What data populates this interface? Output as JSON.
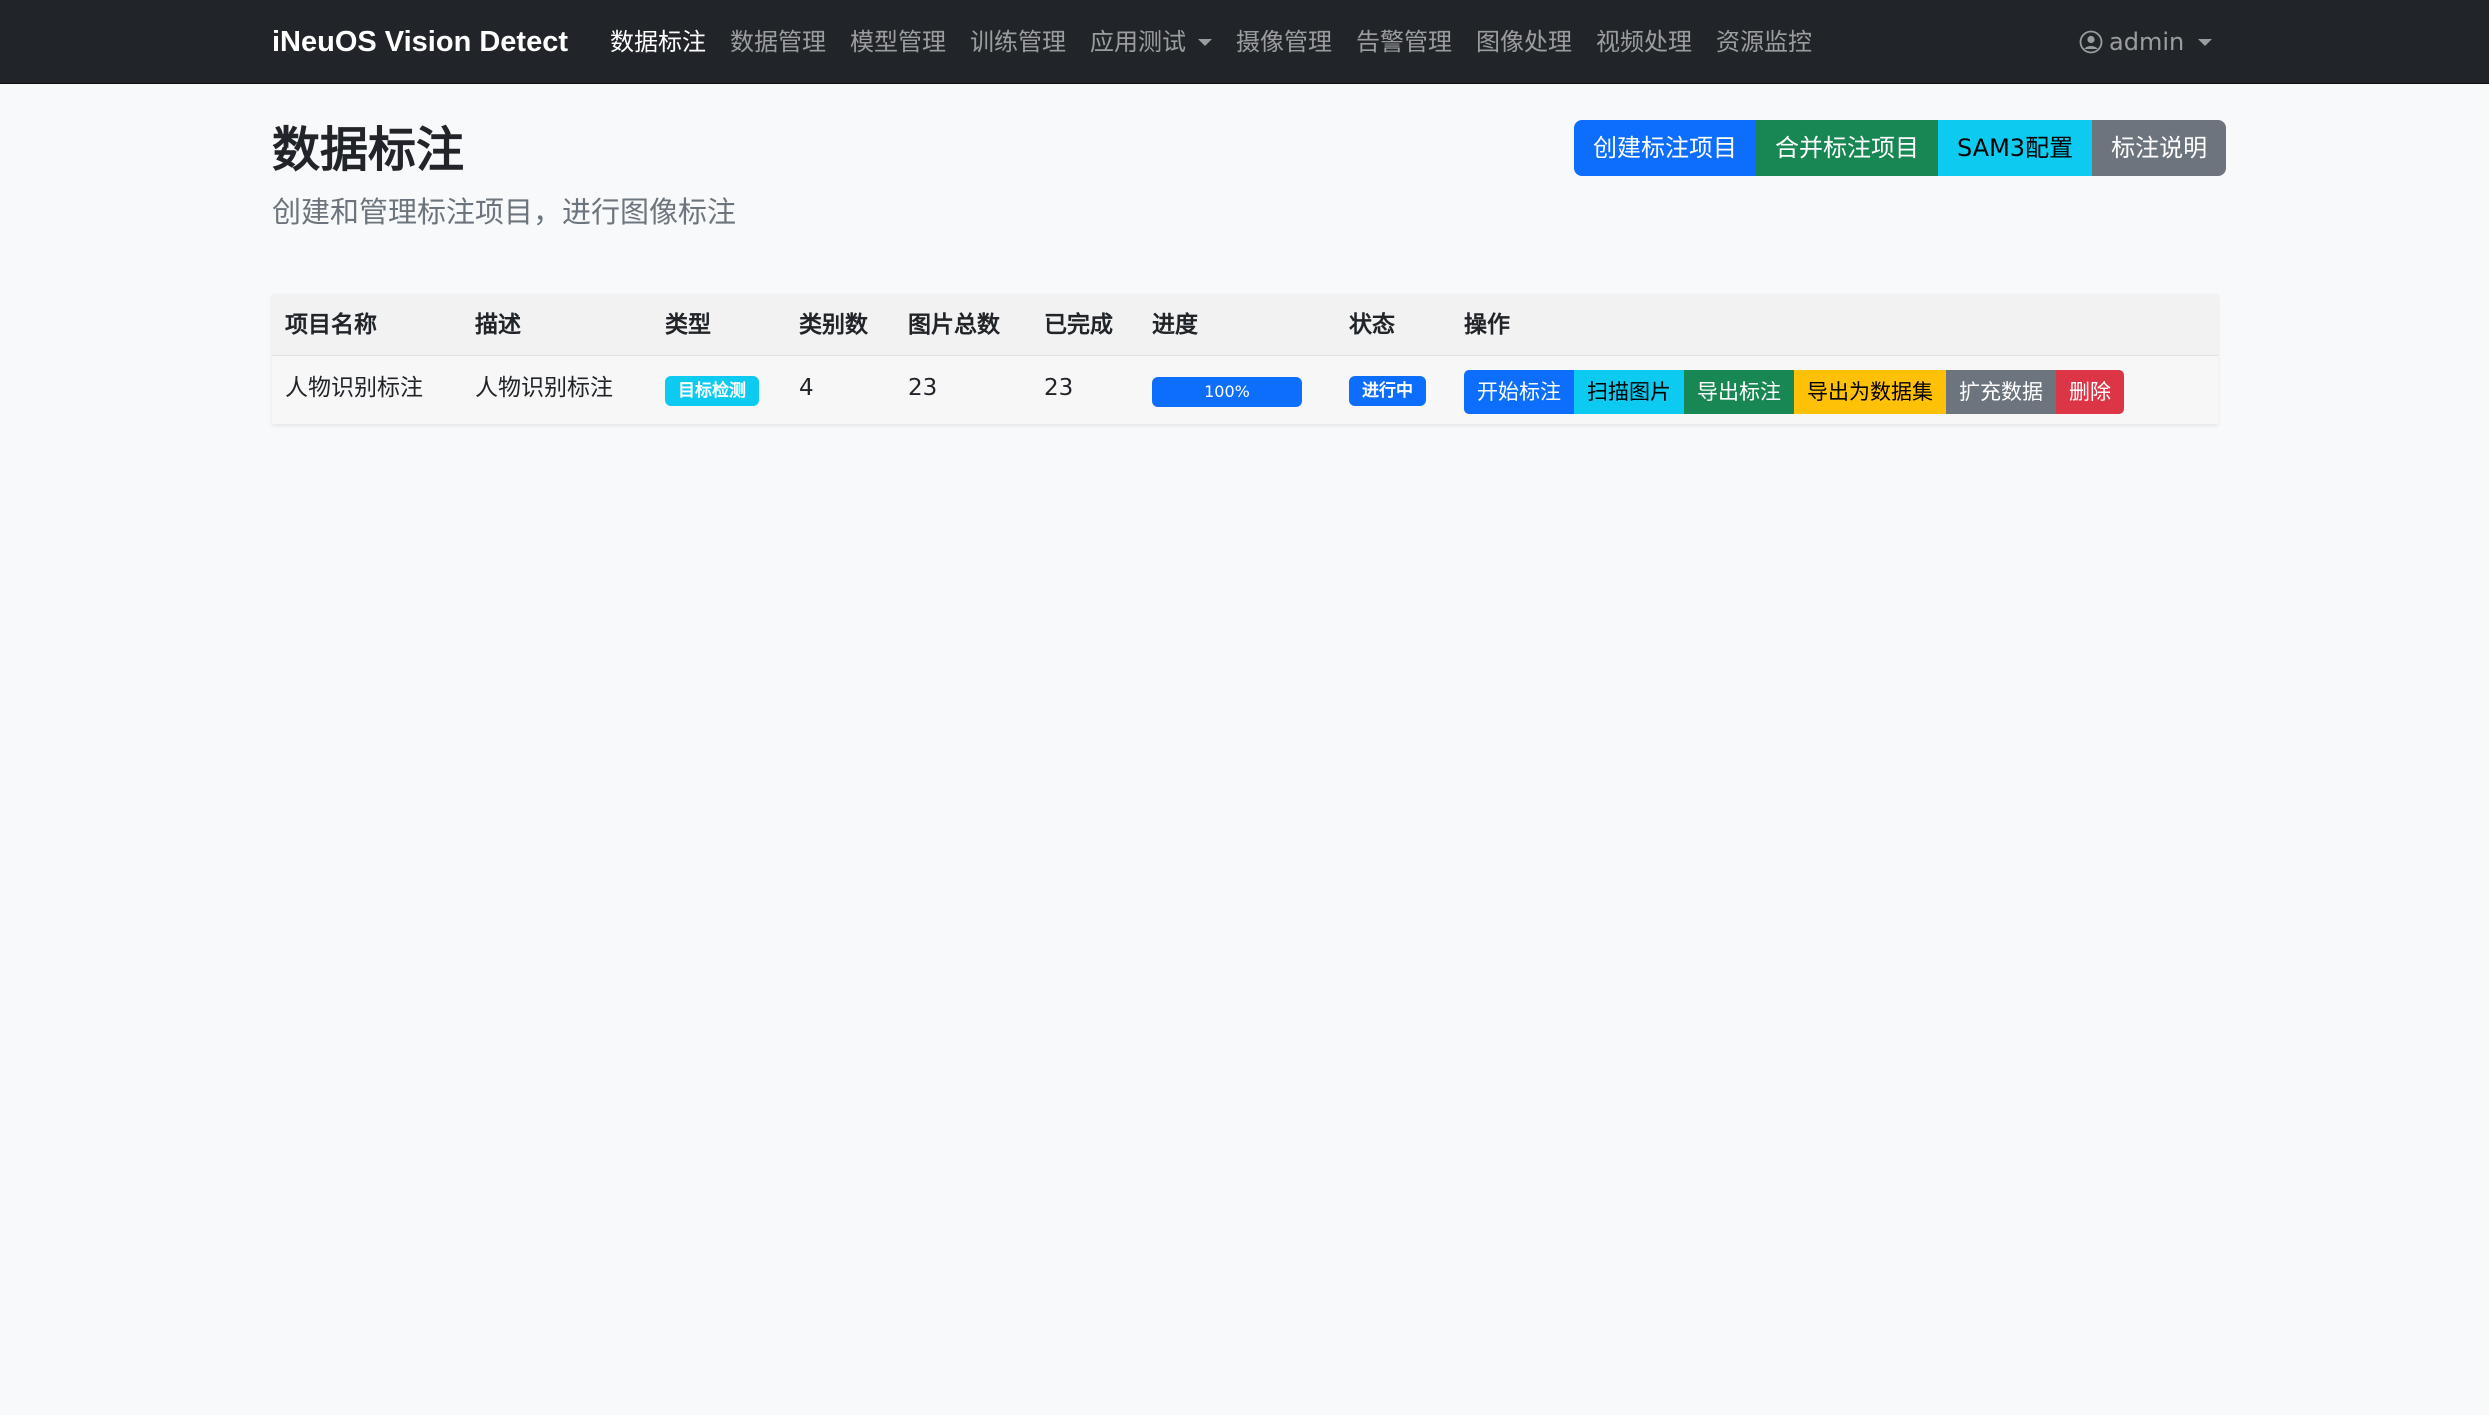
{
  "navbar": {
    "brand": "iNeuOS Vision Detect",
    "items": [
      {
        "label": "数据标注",
        "active": true
      },
      {
        "label": "数据管理"
      },
      {
        "label": "模型管理"
      },
      {
        "label": "训练管理"
      },
      {
        "label": "应用测试",
        "dropdown": true
      },
      {
        "label": "摄像管理"
      },
      {
        "label": "告警管理"
      },
      {
        "label": "图像处理"
      },
      {
        "label": "视频处理"
      },
      {
        "label": "资源监控"
      }
    ],
    "user": {
      "name": "admin",
      "icon": "user-circle-icon"
    }
  },
  "header": {
    "title": "数据标注",
    "subtitle": "创建和管理标注项目，进行图像标注",
    "buttons": {
      "create": "创建标注项目",
      "merge": "合并标注项目",
      "sam3": "SAM3配置",
      "help": "标注说明"
    }
  },
  "table": {
    "headers": {
      "name": "项目名称",
      "desc": "描述",
      "type": "类型",
      "class_count": "类别数",
      "image_total": "图片总数",
      "completed": "已完成",
      "progress": "进度",
      "status": "状态",
      "actions": "操作"
    },
    "rows": [
      {
        "name": "人物识别标注",
        "desc": "人物识别标注",
        "type": "目标检测",
        "class_count": "4",
        "image_total": "23",
        "completed": "23",
        "progress_label": "100%",
        "progress_value": 1.0,
        "status": "进行中",
        "actions": {
          "start": "开始标注",
          "scan": "扫描图片",
          "export": "导出标注",
          "export_dataset": "导出为数据集",
          "augment": "扩充数据",
          "delete": "删除"
        }
      }
    ]
  },
  "colors": {
    "primary": "#0d6efd",
    "success": "#198754",
    "info": "#0dcaf0",
    "secondary": "#6c757d",
    "warning": "#ffc107",
    "danger": "#dc3545",
    "navbar_bg": "#212529"
  }
}
